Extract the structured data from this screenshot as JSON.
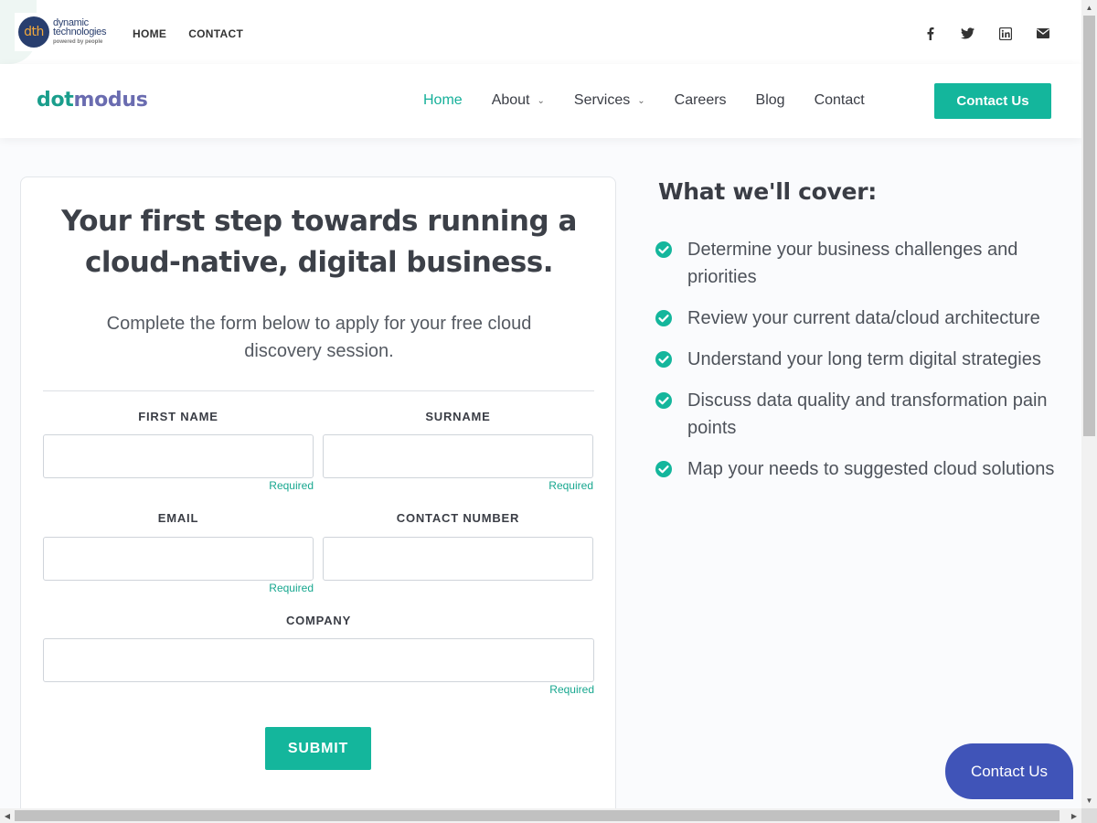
{
  "topbar": {
    "logo": {
      "mark": "dth",
      "line1": "dynamic",
      "line2": "technologies",
      "tagline": "powered by people"
    },
    "links": [
      "HOME",
      "CONTACT"
    ],
    "social_icons": [
      "facebook-icon",
      "twitter-icon",
      "linkedin-icon",
      "mail-icon"
    ]
  },
  "navbar": {
    "brand_part1": "dot",
    "brand_part2": "modus",
    "items": [
      {
        "label": "Home",
        "active": true,
        "dropdown": false
      },
      {
        "label": "About",
        "active": false,
        "dropdown": true
      },
      {
        "label": "Services",
        "active": false,
        "dropdown": true
      },
      {
        "label": "Careers",
        "active": false,
        "dropdown": false
      },
      {
        "label": "Blog",
        "active": false,
        "dropdown": false
      },
      {
        "label": "Contact",
        "active": false,
        "dropdown": false
      }
    ],
    "cta_label": "Contact Us"
  },
  "form": {
    "heading": "Your first step towards running a cloud-native, digital business.",
    "subtitle": "Complete the form below to apply for your free cloud discovery session.",
    "fields": {
      "first_name": {
        "label": "FIRST NAME",
        "value": "",
        "hint": "Required"
      },
      "surname": {
        "label": "SURNAME",
        "value": "",
        "hint": "Required"
      },
      "email": {
        "label": "EMAIL",
        "value": "",
        "hint": "Required"
      },
      "contact_number": {
        "label": "CONTACT NUMBER",
        "value": ""
      },
      "company": {
        "label": "COMPANY",
        "value": "",
        "hint": "Required"
      }
    },
    "submit_label": "SUBMIT"
  },
  "cover": {
    "title": "What we'll cover:",
    "items": [
      "Determine your business challenges and priorities",
      "Review your current data/cloud architecture",
      "Understand your long term digital strategies",
      "Discuss data quality and transformation pain points",
      "Map your needs to suggested cloud solutions"
    ]
  },
  "float_cta_label": "Contact Us",
  "colors": {
    "accent": "#14b69c",
    "float_button": "#4054b8",
    "brand_dot": "#1a9e8c",
    "brand_modus": "#6a6cb0"
  }
}
